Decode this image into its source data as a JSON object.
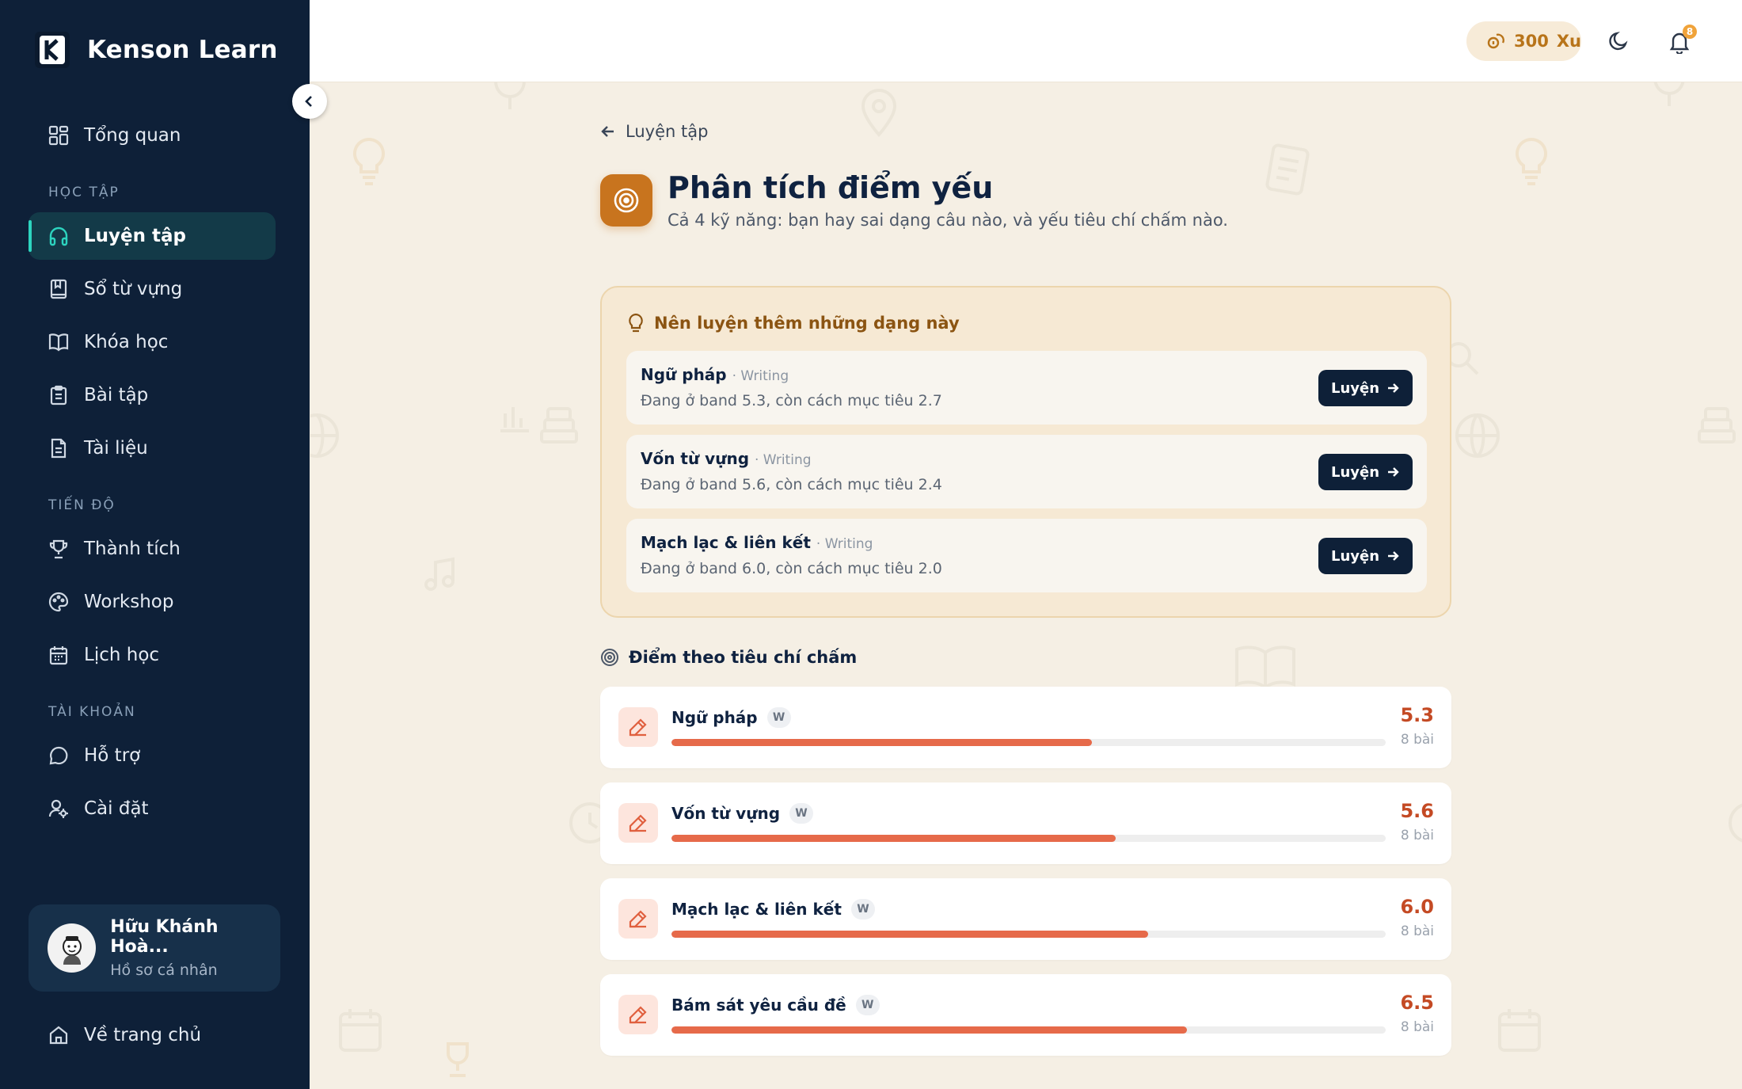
{
  "app": {
    "name": "Kenson Learn"
  },
  "sidebar": {
    "overview": {
      "label": "Tổng quan"
    },
    "sections": {
      "learning": "HỌC TẬP",
      "progress": "TIẾN ĐỘ",
      "account": "TÀI KHOẢN"
    },
    "learning_items": [
      {
        "label": "Luyện tập",
        "icon": "headphones-icon",
        "active": true
      },
      {
        "label": "Sổ từ vựng",
        "icon": "bookmark-book-icon"
      },
      {
        "label": "Khóa học",
        "icon": "open-book-icon"
      },
      {
        "label": "Bài tập",
        "icon": "clipboard-icon"
      },
      {
        "label": "Tài liệu",
        "icon": "document-icon"
      }
    ],
    "progress_items": [
      {
        "label": "Thành tích",
        "icon": "trophy-icon"
      },
      {
        "label": "Workshop",
        "icon": "palette-icon"
      },
      {
        "label": "Lịch học",
        "icon": "calendar-icon"
      }
    ],
    "account_items": [
      {
        "label": "Hỗ trợ",
        "icon": "chat-bubble-icon"
      },
      {
        "label": "Cài đặt",
        "icon": "user-settings-icon"
      }
    ],
    "user": {
      "name": "Hữu Khánh Hoà...",
      "subtitle": "Hồ sơ cá nhân"
    },
    "home_link": {
      "label": "Về trang chủ"
    }
  },
  "topbar": {
    "xu_amount": "300",
    "xu_unit": "Xu",
    "notification_count": "8"
  },
  "main": {
    "back_label": "Luyện tập",
    "title": "Phân tích điểm yếu",
    "subtitle": "Cả 4 kỹ năng: bạn hay sai dạng câu nào, và yếu tiêu chí chấm nào.",
    "recommend": {
      "heading": "Nên luyện thêm những dạng này",
      "button_label": "Luyện",
      "items": [
        {
          "name": "Ngữ pháp",
          "skill": "· Writing",
          "desc": "Đang ở band 5.3, còn cách mục tiêu 2.7"
        },
        {
          "name": "Vốn từ vựng",
          "skill": "· Writing",
          "desc": "Đang ở band 5.6, còn cách mục tiêu 2.4"
        },
        {
          "name": "Mạch lạc & liên kết",
          "skill": "· Writing",
          "desc": "Đang ở band 6.0, còn cách mục tiêu 2.0"
        }
      ]
    },
    "criteria": {
      "heading": "Điểm theo tiêu chí chấm",
      "items": [
        {
          "name": "Ngữ pháp",
          "tag": "W",
          "score": "5.3",
          "count": "8 bài",
          "fraction": 0.589
        },
        {
          "name": "Vốn từ vựng",
          "tag": "W",
          "score": "5.6",
          "count": "8 bài",
          "fraction": 0.622
        },
        {
          "name": "Mạch lạc & liên kết",
          "tag": "W",
          "score": "6.0",
          "count": "8 bài",
          "fraction": 0.667
        },
        {
          "name": "Bám sát yêu cầu đề",
          "tag": "W",
          "score": "6.5",
          "count": "8 bài",
          "fraction": 0.722
        }
      ]
    }
  },
  "colors": {
    "sidebar_bg": "#0e2038",
    "accent_teal": "#2dd4bf",
    "brand_orange": "#c8741e",
    "score_red": "#c44a24",
    "bar_fill": "#e66a4a",
    "page_bg": "#f5efe4"
  }
}
